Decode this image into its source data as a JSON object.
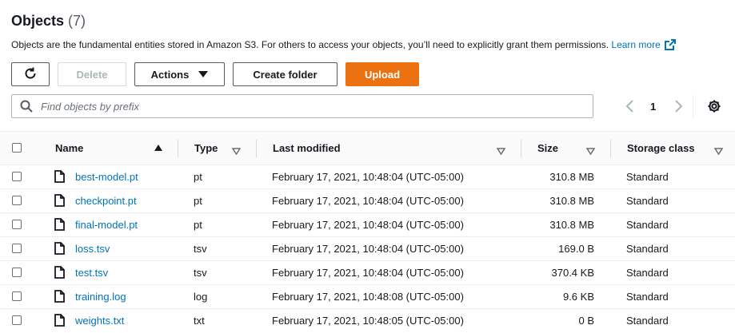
{
  "header": {
    "title": "Objects",
    "count": "(7)",
    "description": "Objects are the fundamental entities stored in Amazon S3. For others to access your objects, you’ll need to explicitly grant them permissions.",
    "learn_more": "Learn more"
  },
  "toolbar": {
    "delete_label": "Delete",
    "actions_label": "Actions",
    "create_folder_label": "Create folder",
    "upload_label": "Upload"
  },
  "search": {
    "placeholder": "Find objects by prefix",
    "value": ""
  },
  "pagination": {
    "current_page": "1"
  },
  "table": {
    "columns": {
      "name": "Name",
      "type": "Type",
      "last_modified": "Last modified",
      "size": "Size",
      "storage_class": "Storage class"
    },
    "rows": [
      {
        "name": "best-model.pt",
        "type": "pt",
        "last_modified": "February 17, 2021, 10:48:04 (UTC-05:00)",
        "size": "310.8 MB",
        "storage_class": "Standard"
      },
      {
        "name": "checkpoint.pt",
        "type": "pt",
        "last_modified": "February 17, 2021, 10:48:04 (UTC-05:00)",
        "size": "310.8 MB",
        "storage_class": "Standard"
      },
      {
        "name": "final-model.pt",
        "type": "pt",
        "last_modified": "February 17, 2021, 10:48:04 (UTC-05:00)",
        "size": "310.8 MB",
        "storage_class": "Standard"
      },
      {
        "name": "loss.tsv",
        "type": "tsv",
        "last_modified": "February 17, 2021, 10:48:04 (UTC-05:00)",
        "size": "169.0 B",
        "storage_class": "Standard"
      },
      {
        "name": "test.tsv",
        "type": "tsv",
        "last_modified": "February 17, 2021, 10:48:04 (UTC-05:00)",
        "size": "370.4 KB",
        "storage_class": "Standard"
      },
      {
        "name": "training.log",
        "type": "log",
        "last_modified": "February 17, 2021, 10:48:08 (UTC-05:00)",
        "size": "9.6 KB",
        "storage_class": "Standard"
      },
      {
        "name": "weights.txt",
        "type": "txt",
        "last_modified": "February 17, 2021, 10:48:05 (UTC-05:00)",
        "size": "0 B",
        "storage_class": "Standard"
      }
    ]
  },
  "colors": {
    "link": "#0073bb",
    "primary_button": "#ec7211",
    "border": "#545b64",
    "disabled": "#aab7b8"
  },
  "icons": {
    "refresh": "refresh-icon",
    "external": "external-link-icon",
    "search": "search-icon",
    "prev": "chevron-left-icon",
    "next": "chevron-right-icon",
    "settings": "gear-icon",
    "file": "file-icon",
    "sort_asc": "sort-ascending-icon",
    "sort": "sort-descending-icon"
  }
}
